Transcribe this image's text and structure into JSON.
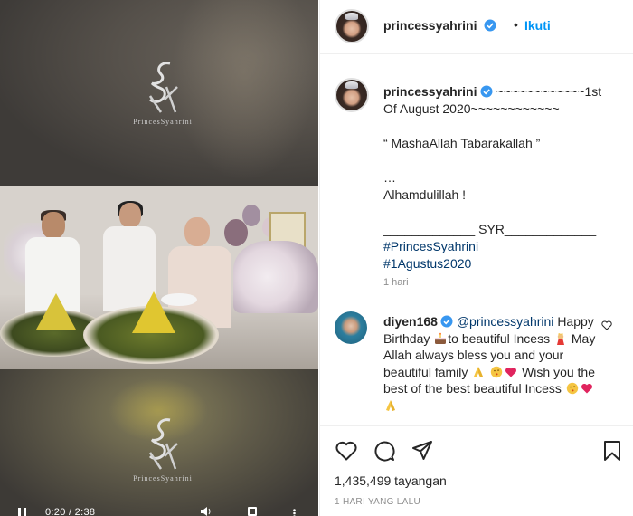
{
  "post": {
    "username": "princessyahrini",
    "follow_label": "Ikuti",
    "separator": "•",
    "caption_lines": [
      "~~~~~~~~~~~~1st",
      "Of August 2020~~~~~~~~~~~~",
      "",
      "“ MashaAllah Tabarakallah ”",
      "",
      "…",
      "Alhamdulillah !",
      "",
      "_____________ SYR_____________"
    ],
    "hashtags": [
      "#PrincesSyahrini",
      "#1Agustus2020"
    ],
    "time_ago": "1 hari",
    "views": "1,435,499 tayangan",
    "date": "1 HARI YANG LALU"
  },
  "comment": {
    "username": "diyen168",
    "mention": "@princessyahrini",
    "text_1": "Happy Birthday",
    "text_2": "to beautiful Incess",
    "text_3": "May Allah always bless you and your beautiful family",
    "text_4": "Wish you the best of the best beautiful Incess"
  },
  "video": {
    "time": "0:20 / 2:38",
    "watermark": "PrincesSyahrini"
  },
  "icons": {
    "verified": "verified-badge-icon",
    "like": "heart-icon",
    "comment": "comment-icon",
    "share": "paper-plane-icon",
    "save": "bookmark-icon"
  },
  "colors": {
    "link_blue": "#0095f6",
    "hashtag": "#00376b",
    "muted": "#8e8e8e",
    "verified": "#3897f0"
  }
}
